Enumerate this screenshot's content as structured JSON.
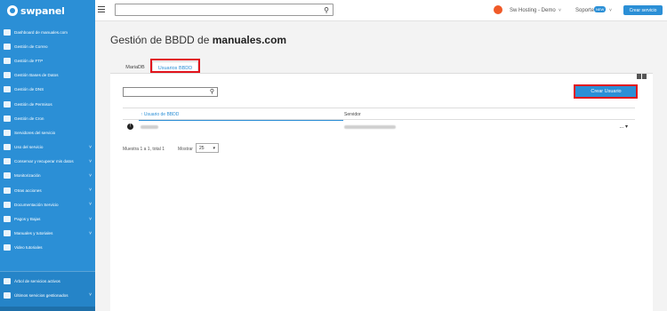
{
  "brand": {
    "name": "swpanel"
  },
  "sidebar": {
    "items": [
      {
        "label": "Dashboard de manuales.com",
        "icon": "dashboard-icon",
        "chevron": ""
      },
      {
        "label": "Gestión de Correo",
        "icon": "mail-icon",
        "chevron": ""
      },
      {
        "label": "Gestión de FTP",
        "icon": "database-icon",
        "chevron": ""
      },
      {
        "label": "Gestión Bases de Datos",
        "icon": "database-icon",
        "chevron": ""
      },
      {
        "label": "Gestión de DNS",
        "icon": "flag-icon",
        "chevron": ""
      },
      {
        "label": "Gestión de Permisos",
        "icon": "permissions-icon",
        "chevron": ""
      },
      {
        "label": "Gestión de Cron",
        "icon": "gear-icon",
        "chevron": ""
      },
      {
        "label": "Servidores del servicio",
        "icon": "server-icon",
        "chevron": ""
      },
      {
        "label": "Uso del servicio",
        "icon": "chart-icon",
        "chevron": "˅"
      },
      {
        "label": "Conservar y recuperar mis datos",
        "icon": "backup-icon",
        "chevron": "˅"
      },
      {
        "label": "Monitorización",
        "icon": "monitor-icon",
        "chevron": "˅"
      },
      {
        "label": "Otras acciones",
        "icon": "actions-icon",
        "chevron": "˅"
      },
      {
        "label": "Documentación Servicio",
        "icon": "document-icon",
        "chevron": "˅"
      },
      {
        "label": "Pagos y Bajas",
        "icon": "payments-icon",
        "chevron": "˅"
      },
      {
        "label": "Manuales y tutoriales",
        "icon": "help-icon",
        "chevron": "˅"
      },
      {
        "label": "Video tutoriales",
        "icon": "video-icon",
        "chevron": ""
      }
    ],
    "bottom_items": [
      {
        "label": "Árbol de servicios activos",
        "icon": "tree-icon",
        "chevron": ""
      },
      {
        "label": "Últimos servicios gestionados",
        "icon": "recent-icon",
        "chevron": "˅"
      }
    ]
  },
  "topbar": {
    "search_value": "",
    "org_name": "Sw Hosting - Demo",
    "support_label": "Soporte",
    "support_badge": "NEW",
    "create_service_label": "Crear servicio",
    "caret": "˅"
  },
  "page": {
    "title_prefix": "Gestión de BBDD de ",
    "title_domain": "manuales.com"
  },
  "tabs": [
    {
      "label": "MariaDB",
      "active": false
    },
    {
      "label": "Usuarios BBDD",
      "active": true
    }
  ],
  "panel": {
    "search_value": "",
    "create_user_label": "Crear Usuario",
    "columns": {
      "user": "Usuario de BBDD",
      "server": "Servidor"
    },
    "row_menu": "... ▾",
    "info_icon_glyph": "!",
    "summary": "Muestra 1 a 1, total 1",
    "show_label": "Mostrar",
    "show_value": "25"
  },
  "colors": {
    "sidebar": "#2b8fd6",
    "accent": "#2b8fd6",
    "highlight": "#e1141c",
    "org_icon": "#f05a28"
  }
}
